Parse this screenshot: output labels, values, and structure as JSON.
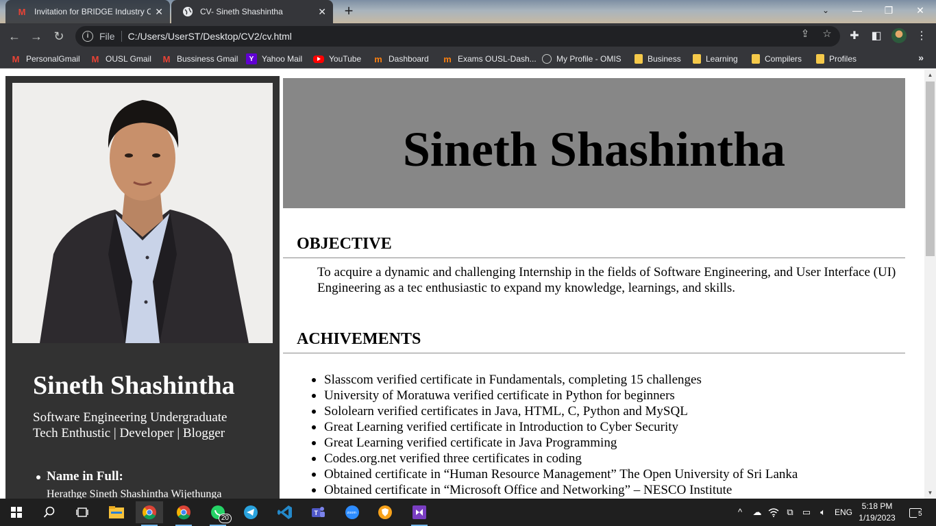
{
  "browser": {
    "tabs": [
      {
        "title": "Invitation for BRIDGE Industry Co",
        "active": false
      },
      {
        "title": "CV- Sineth Shashintha",
        "active": true
      }
    ],
    "address": {
      "scheme": "File",
      "url": "C:/Users/UserST/Desktop/CV2/cv.html"
    },
    "bookmarks": [
      {
        "label": "PersonalGmail",
        "icon": "gmail-icon"
      },
      {
        "label": "OUSL Gmail",
        "icon": "gmail-icon"
      },
      {
        "label": "Bussiness Gmail",
        "icon": "gmail-icon"
      },
      {
        "label": "Yahoo Mail",
        "icon": "yahoo-icon"
      },
      {
        "label": "YouTube",
        "icon": "youtube-icon"
      },
      {
        "label": "Dashboard",
        "icon": "moodle-icon"
      },
      {
        "label": "Exams OUSL-Dash...",
        "icon": "moodle-icon"
      },
      {
        "label": "My Profile - OMIS",
        "icon": "globe-icon"
      },
      {
        "label": "Business",
        "icon": "folder-icon"
      },
      {
        "label": "Learning",
        "icon": "folder-icon"
      },
      {
        "label": "Compilers",
        "icon": "folder-icon"
      },
      {
        "label": "Profiles",
        "icon": "folder-icon"
      }
    ],
    "bookmarks_more": "»"
  },
  "cv": {
    "name": "Sineth Shashintha",
    "sidebar": {
      "name": "Sineth Shashintha",
      "tagline1": "Software Engineering Undergraduate",
      "tagline2": "Tech Enthustic | Developer | Blogger",
      "full_name_label": "Name in Full:",
      "full_name_value": "Herathge Sineth Shashintha Wijethunga"
    },
    "objective": {
      "title": "OBJECTIVE",
      "text": "To acquire a dynamic and challenging Internship in the fields of Software Engineering, and User Interface (UI) Engineering as a tec enthusiastic to expand my knowledge, learnings, and skills."
    },
    "achievements": {
      "title": "ACHIVEMENTS",
      "items": [
        "Slasscom verified certificate in Fundamentals, completing 15 challenges",
        "University of Moratuwa verified certificate in Python for beginners",
        "Sololearn verified certificates in Java, HTML, C, Python and MySQL",
        "Great Learning verified certificate in Introduction to Cyber Security",
        "Great Learning verified certificate in Java Programming",
        "Codes.org.net verified three certificates in coding",
        "Obtained certificate in “Human Resource Management” The Open University of Sri Lanka",
        "Obtained certificate in “Microsoft Office and Networking” – NESCO Institute"
      ]
    }
  },
  "taskbar": {
    "whatsapp_badge": "20",
    "lang": "ENG",
    "time": "5:18 PM",
    "date": "1/19/2023",
    "notifications": "5"
  }
}
